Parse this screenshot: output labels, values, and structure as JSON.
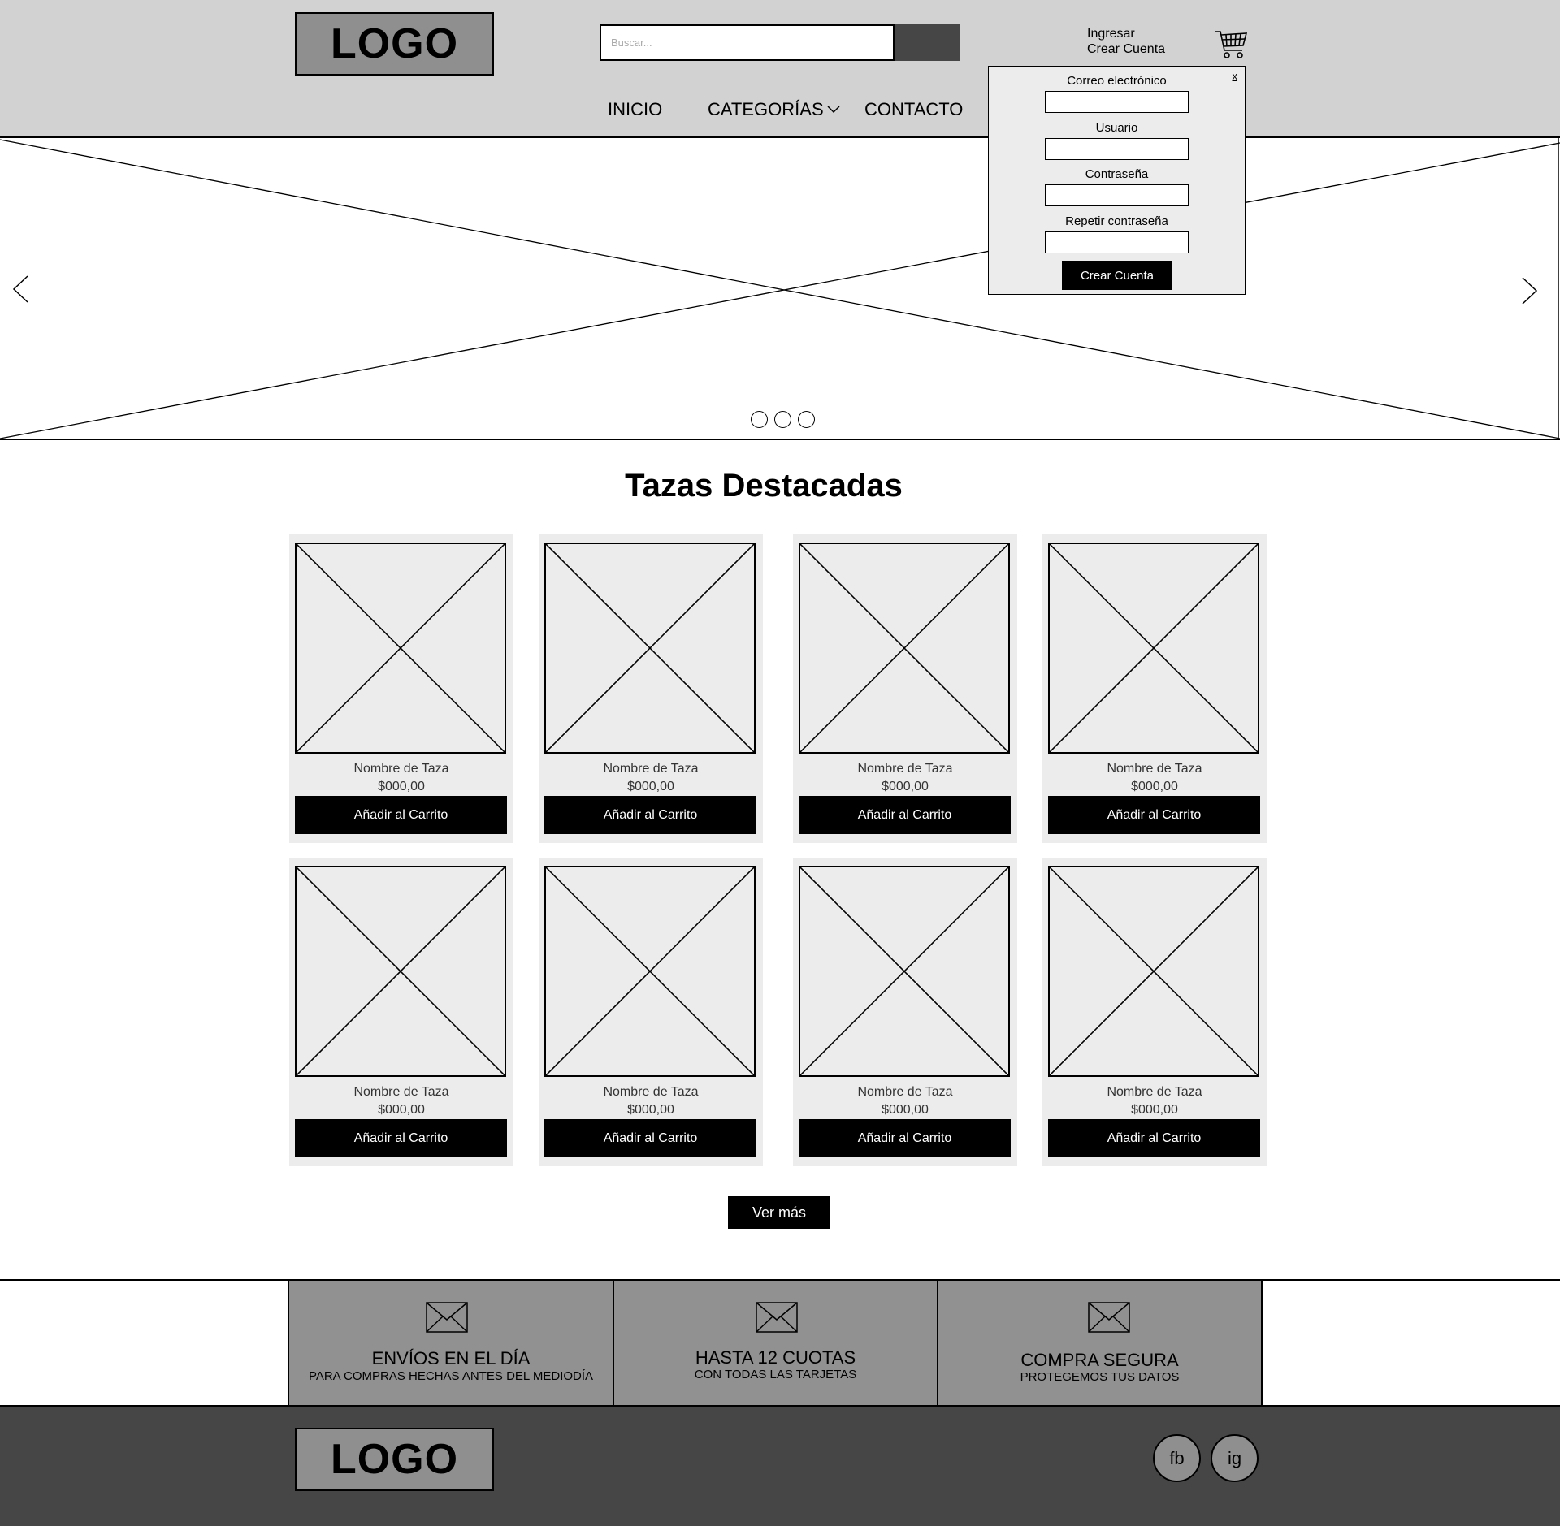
{
  "header": {
    "logo_text": "LOGO",
    "search_placeholder": "Buscar...",
    "login_link": "Ingresar",
    "register_link": "Crear Cuenta",
    "nav": {
      "inicio": "INICIO",
      "categorias": "CATEGORÍAS",
      "contacto": "CONTACTO"
    }
  },
  "register_popup": {
    "close_label": "x",
    "email_label": "Correo electrónico",
    "user_label": "Usuario",
    "password_label": "Contraseña",
    "repeat_password_label": "Repetir contraseña",
    "submit_label": "Crear Cuenta"
  },
  "hero": {
    "slides_count": 3
  },
  "featured": {
    "title": "Tazas Destacadas",
    "products": [
      {
        "name": "Nombre de Taza",
        "price": "$000,00",
        "button": "Añadir al Carrito"
      },
      {
        "name": "Nombre de Taza",
        "price": "$000,00",
        "button": "Añadir al Carrito"
      },
      {
        "name": "Nombre de Taza",
        "price": "$000,00",
        "button": "Añadir al Carrito"
      },
      {
        "name": "Nombre de Taza",
        "price": "$000,00",
        "button": "Añadir al Carrito"
      },
      {
        "name": "Nombre de Taza",
        "price": "$000,00",
        "button": "Añadir al Carrito"
      },
      {
        "name": "Nombre de Taza",
        "price": "$000,00",
        "button": "Añadir al Carrito"
      },
      {
        "name": "Nombre de Taza",
        "price": "$000,00",
        "button": "Añadir al Carrito"
      },
      {
        "name": "Nombre de Taza",
        "price": "$000,00",
        "button": "Añadir al Carrito"
      }
    ],
    "more_button": "Ver más"
  },
  "features": [
    {
      "title": "ENVÍOS EN EL DÍA",
      "subtitle": "PARA COMPRAS HECHAS ANTES DEL MEDIODÍA",
      "icon": "envelope-icon"
    },
    {
      "title": "HASTA 12 CUOTAS",
      "subtitle": "CON TODAS LAS TARJETAS",
      "icon": "envelope-icon"
    },
    {
      "title": "COMPRA SEGURA",
      "subtitle": "PROTEGEMOS TUS DATOS",
      "icon": "envelope-icon"
    }
  ],
  "footer": {
    "logo_text": "LOGO",
    "social": {
      "facebook": "fb",
      "instagram": "ig"
    }
  },
  "colors": {
    "header_bg": "#d2d2d2",
    "logo_bg": "#8f8f8f",
    "footer_bg": "#464646",
    "card_bg": "#ececec",
    "feature_bg": "#919191",
    "button_bg": "#000000"
  }
}
